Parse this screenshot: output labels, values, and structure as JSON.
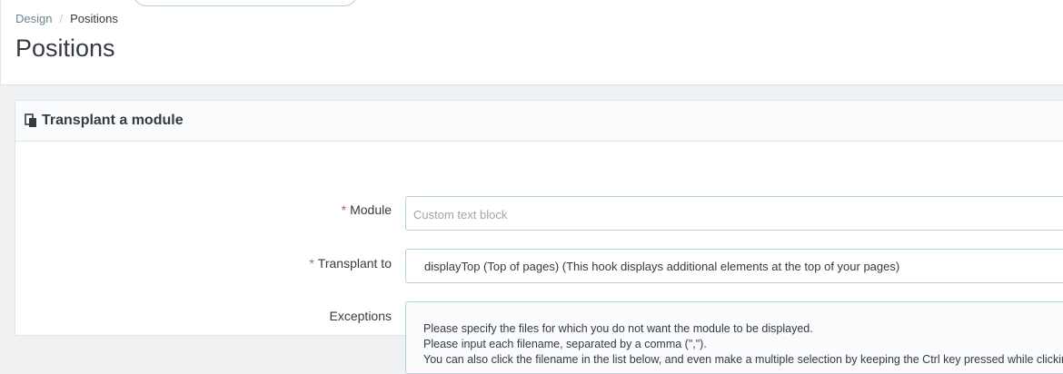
{
  "breadcrumb": {
    "parent": "Design",
    "separator": "/",
    "current": "Positions"
  },
  "page": {
    "title": "Positions"
  },
  "panel": {
    "heading": "Transplant a module",
    "icon": "module-transplant-icon"
  },
  "form": {
    "module": {
      "label": "Module",
      "required_mark": "*",
      "placeholder": "Custom text block"
    },
    "transplant_to": {
      "label": "Transplant to",
      "required_mark": "*",
      "value": "displayTop (Top of pages) (This hook displays additional elements at the top of your pages)"
    },
    "exceptions": {
      "label": "Exceptions",
      "help_lines": [
        "Please specify the files for which you do not want the module to be displayed.",
        "Please input each filename, separated by a comma (\",\").",
        "You can also click the filename in the list below, and even make a multiple selection by keeping the Ctrl key pressed while clicking"
      ]
    }
  }
}
